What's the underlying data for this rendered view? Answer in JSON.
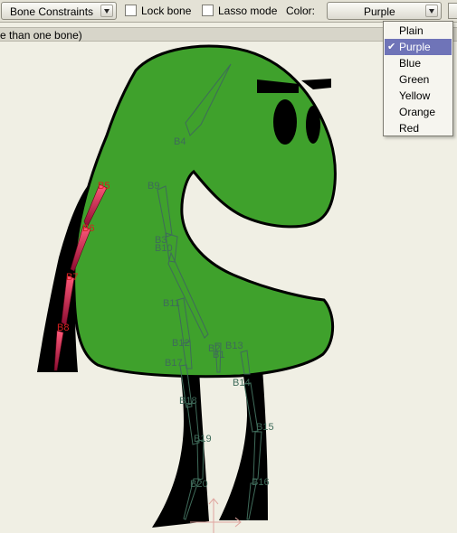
{
  "toolbar": {
    "mode_dropdown": "Bone Constraints",
    "lock_bone_label": "Lock bone",
    "lasso_mode_label": "Lasso mode",
    "color_label": "Color:",
    "color_value": "Purple"
  },
  "hint_text": "e than one bone)",
  "color_menu": {
    "options": [
      "Plain",
      "Purple",
      "Blue",
      "Green",
      "Yellow",
      "Orange",
      "Red"
    ],
    "selected": "Purple"
  },
  "bones": [
    {
      "id": "B1",
      "color": "#3f6b5a"
    },
    {
      "id": "B2",
      "color": "#3f6b5a"
    },
    {
      "id": "B3",
      "color": "#3f6b5a"
    },
    {
      "id": "B4",
      "color": "#3f6b5a"
    },
    {
      "id": "B5",
      "color": "#d42020"
    },
    {
      "id": "B6",
      "color": "#d42020"
    },
    {
      "id": "B7",
      "color": "#d42020"
    },
    {
      "id": "B8",
      "color": "#d42020"
    },
    {
      "id": "B9",
      "color": "#3f6b5a"
    },
    {
      "id": "B10",
      "color": "#3f6b5a"
    },
    {
      "id": "B11",
      "color": "#3f6b5a"
    },
    {
      "id": "B12",
      "color": "#3f6b5a"
    },
    {
      "id": "B13",
      "color": "#3f6b5a"
    },
    {
      "id": "B14",
      "color": "#3f6b5a"
    },
    {
      "id": "B15",
      "color": "#3f6b5a"
    },
    {
      "id": "B16",
      "color": "#3f6b5a"
    },
    {
      "id": "B17",
      "color": "#3f6b5a"
    },
    {
      "id": "B18",
      "color": "#3f6b5a"
    },
    {
      "id": "B19",
      "color": "#3f6b5a"
    },
    {
      "id": "B20",
      "color": "#3f6b5a"
    }
  ],
  "colors": {
    "body_fill": "#3fa12c",
    "outline": "#000000",
    "canvas_bg": "#f0efe4",
    "selected_bone": "#c8124a",
    "bone_line": "#3f6b5a",
    "menu_highlight": "#6f74b8"
  }
}
